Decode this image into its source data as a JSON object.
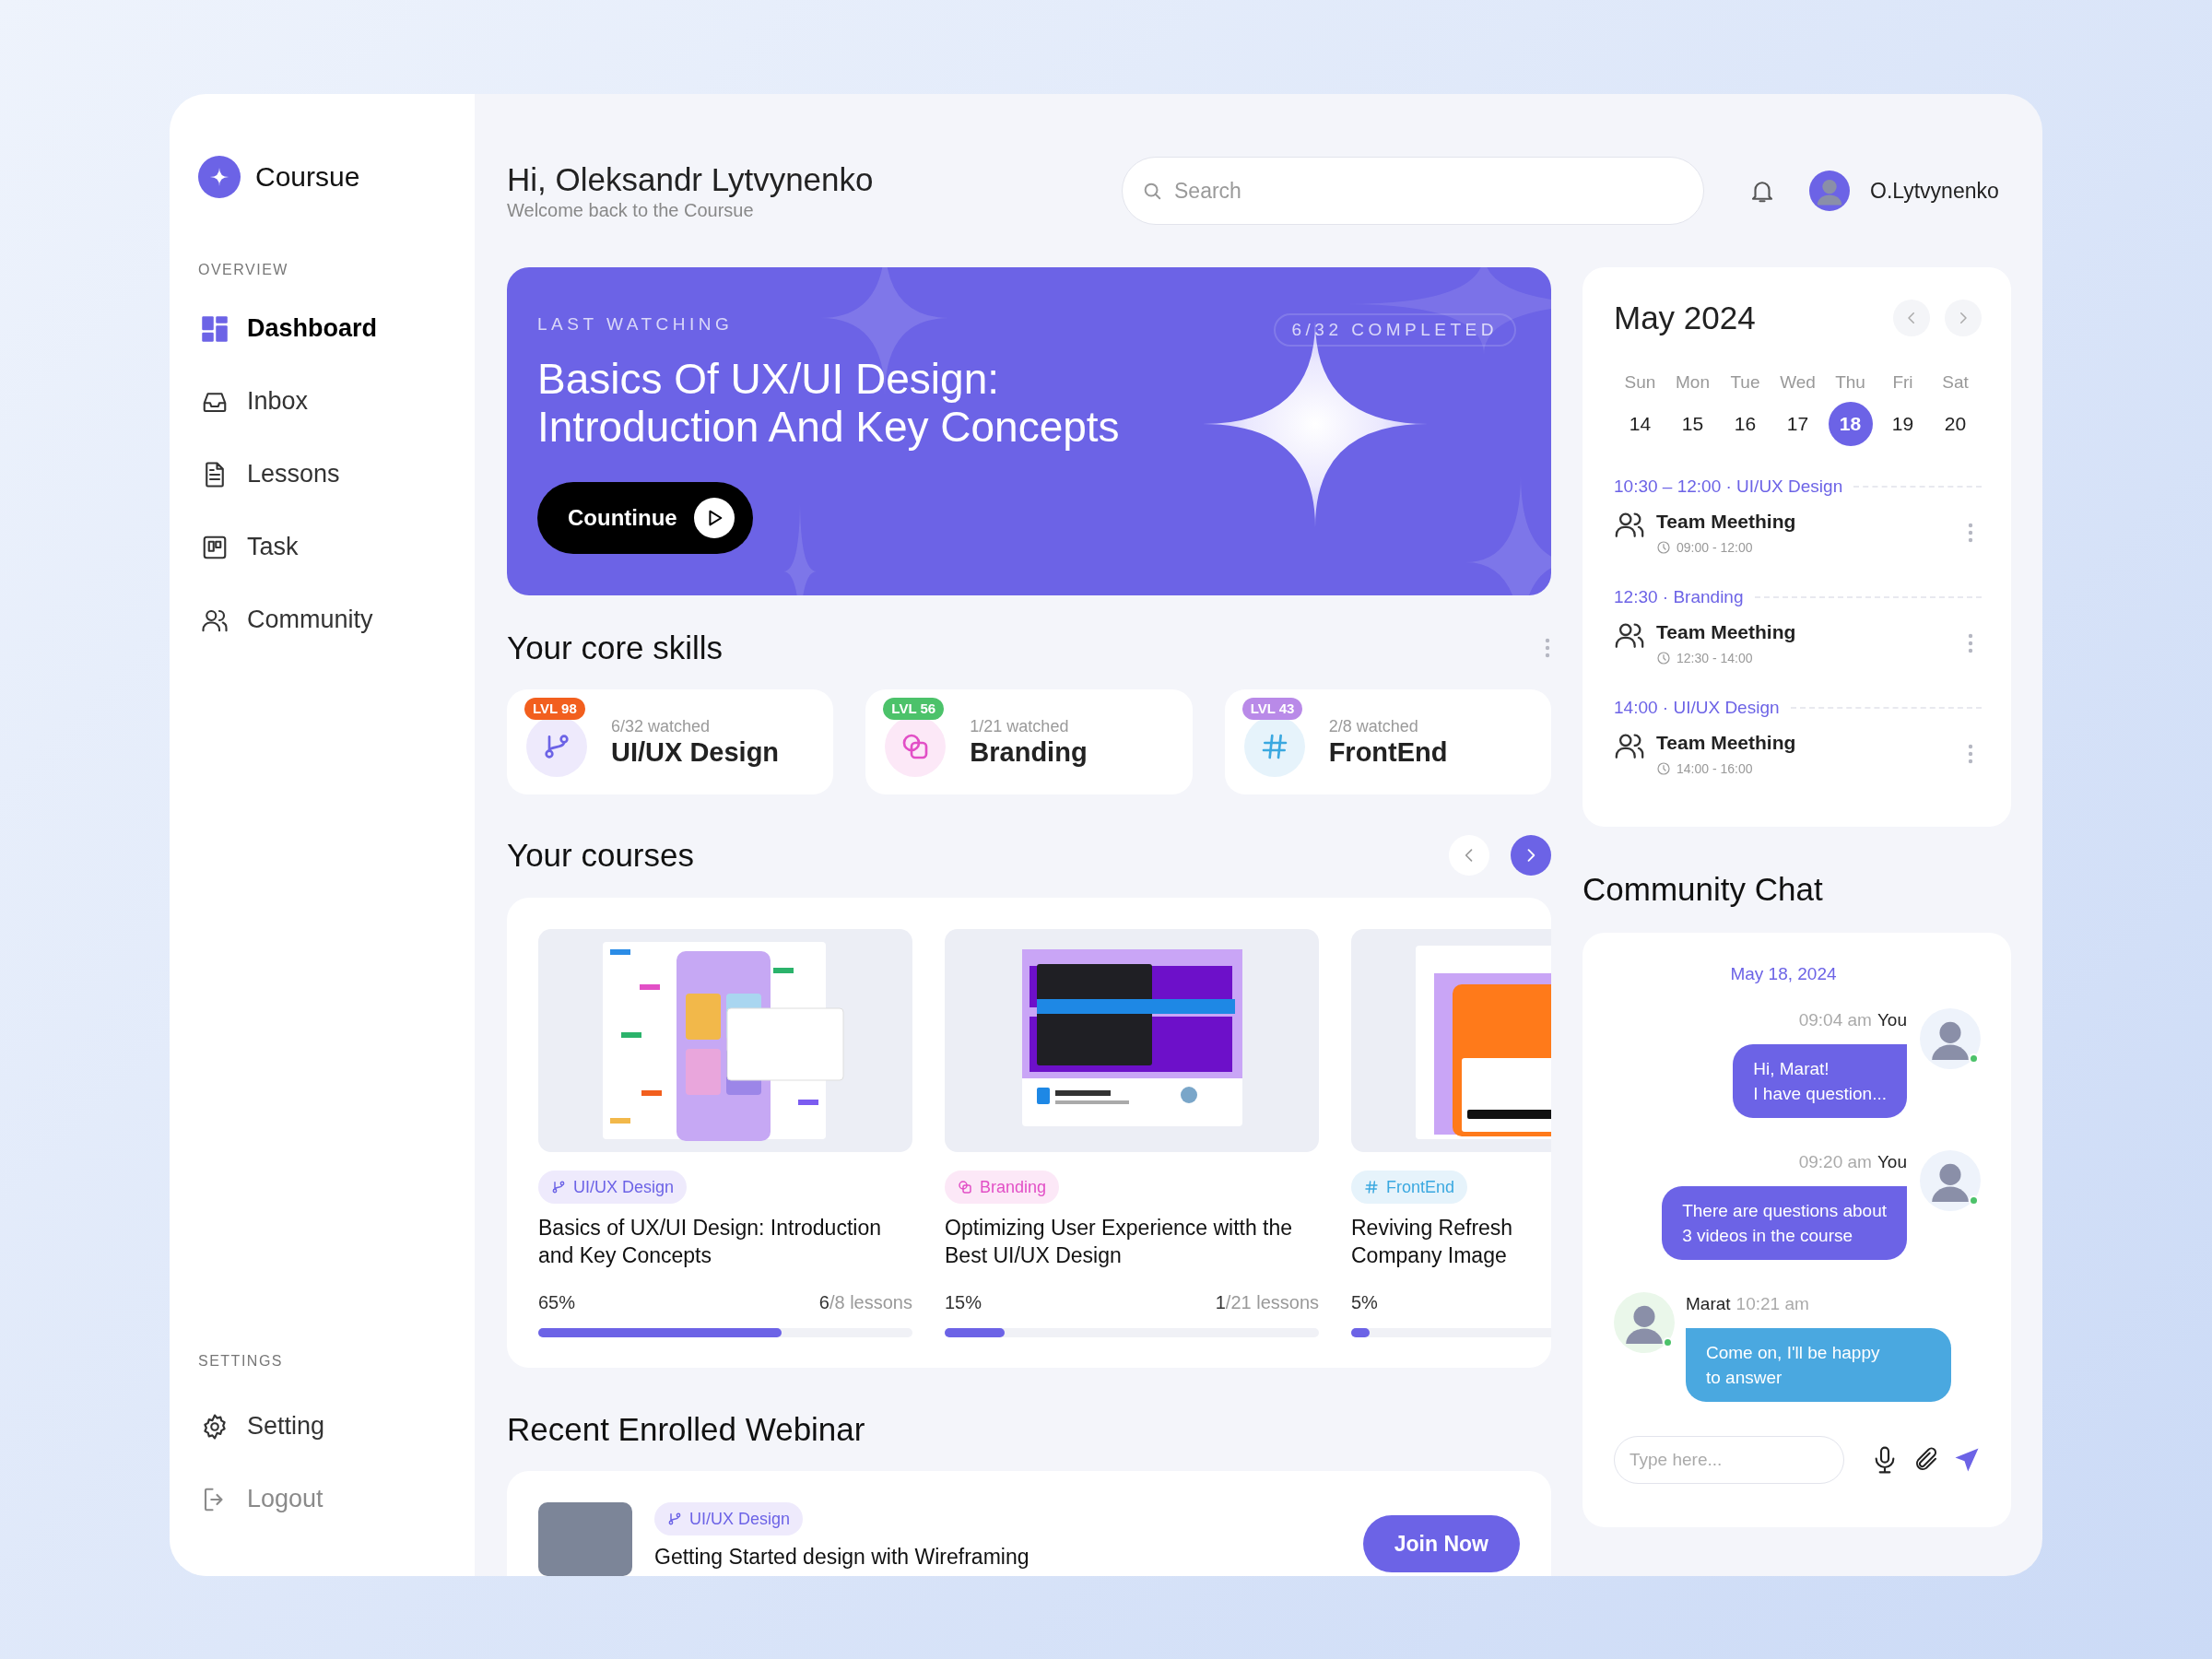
{
  "app": {
    "name": "Coursue"
  },
  "sidebar": {
    "sections": [
      {
        "label": "OVERVIEW",
        "items": [
          {
            "label": "Dashboard",
            "selected": true,
            "muted": false
          },
          {
            "label": "Inbox",
            "selected": false,
            "muted": false
          },
          {
            "label": "Lessons",
            "selected": false,
            "muted": false
          },
          {
            "label": "Task",
            "selected": false,
            "muted": false
          },
          {
            "label": "Community",
            "selected": false,
            "muted": false
          }
        ]
      },
      {
        "label": "SETTINGS",
        "items": [
          {
            "label": "Setting",
            "selected": false,
            "muted": false
          },
          {
            "label": "Logout",
            "selected": false,
            "muted": true
          }
        ]
      }
    ]
  },
  "header": {
    "greeting": "Hi, Oleksandr Lytvynenko",
    "subtitle": "Welcome back to the Coursue",
    "search": {
      "placeholder": "Search"
    },
    "user": {
      "name": "O.Lytvynenko"
    }
  },
  "hero": {
    "eyebrow": "LAST WATCHING",
    "progress": "6/32 COMPLETED",
    "title_lines": [
      "Basics Of UX/UI Design:",
      "Introduction And Key Concepts"
    ],
    "button": "Countinue"
  },
  "skills": {
    "title": "Your core skills",
    "items": [
      {
        "badge": "LVL 98",
        "color": "#f25f1e",
        "kind": "design",
        "watched": "6/32 watched",
        "name": "UI/UX Design"
      },
      {
        "badge": "LVL 56",
        "color": "#4cc26a",
        "kind": "branding",
        "watched": "1/21 watched",
        "name": "Branding"
      },
      {
        "badge": "LVL 43",
        "color": "#b98ae8",
        "kind": "frontend",
        "watched": "2/8 watched",
        "name": "FrontEnd"
      }
    ]
  },
  "courses": {
    "title": "Your courses",
    "items": [
      {
        "kind": "design",
        "tag": "UI/UX Design",
        "title": "Basics of UX/UI Design: Introduction and Key Concepts",
        "percent": "65%",
        "lessons_done": "6",
        "lessons_total": "/8 lessons",
        "level": 0.65
      },
      {
        "kind": "branding",
        "tag": "Branding",
        "title": "Optimizing User Experience witth the Best UI/UX Design",
        "percent": "15%",
        "lessons_done": "1",
        "lessons_total": "/21 lessons",
        "level": 0.16
      },
      {
        "kind": "frontend",
        "tag": "FrontEnd",
        "title": "Reviving Refresh Company Image",
        "percent": "5%",
        "level": 0.05
      }
    ]
  },
  "webinar": {
    "title": "Recent Enrolled Webinar",
    "items": [
      {
        "kind": "design",
        "tag": "UI/UX Design",
        "title": "Getting Started design with Wireframing",
        "button": "Join Now"
      }
    ]
  },
  "calendar": {
    "month": "May 2024",
    "weekdays": [
      "Sun",
      "Mon",
      "Tue",
      "Wed",
      "Thu",
      "Fri",
      "Sat"
    ],
    "days": [
      {
        "label": "14",
        "selected": false
      },
      {
        "label": "15",
        "selected": false
      },
      {
        "label": "16",
        "selected": false
      },
      {
        "label": "17",
        "selected": false
      },
      {
        "label": "18",
        "selected": true
      },
      {
        "label": "19",
        "selected": false
      },
      {
        "label": "20",
        "selected": false
      }
    ],
    "events": [
      {
        "time": "10:30 – 12:00 · UI/UX Design",
        "title": "Team Meething",
        "range": "09:00 - 12:00"
      },
      {
        "time": "12:30 · Branding",
        "title": "Team Meething",
        "range": "12:30 - 14:00"
      },
      {
        "time": "14:00 · UI/UX Design",
        "title": "Team Meething",
        "range": "14:00 - 16:00"
      }
    ]
  },
  "chat": {
    "title": "Community Chat",
    "date": "May 18, 2024",
    "messages": [
      {
        "kind": "sent",
        "time": "09:04 am",
        "author": "You",
        "text": "Hi, Marat!\nI have question...",
        "online": true
      },
      {
        "kind": "sent",
        "time": "09:20 am",
        "author": "You",
        "text": "There are questions about\n3 videos in the course",
        "online": true
      },
      {
        "kind": "received",
        "time": "10:21 am",
        "author": "Marat",
        "text": "Come on, I'll be happy\nto answer",
        "online": true
      }
    ],
    "input": {
      "placeholder": "Type here..."
    }
  }
}
